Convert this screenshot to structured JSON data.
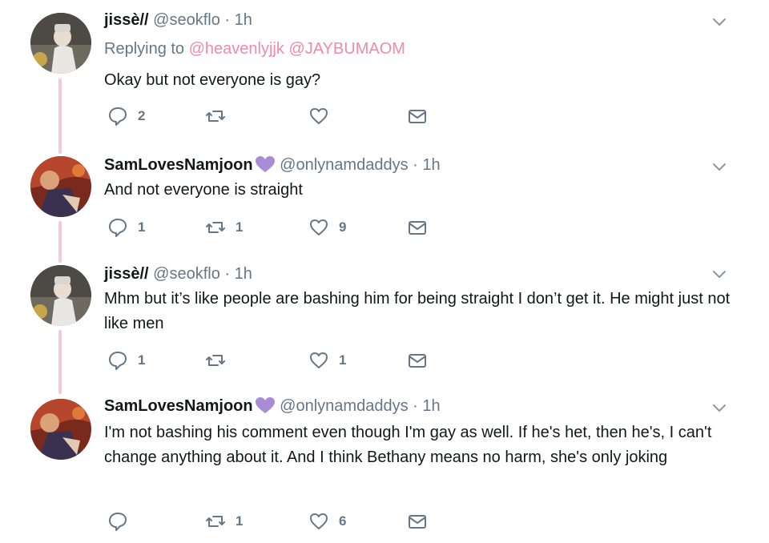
{
  "tweets": [
    {
      "name": "jissè//",
      "handle": "@seokflo",
      "sep": "·",
      "time": "1h",
      "replying_label": "Replying to",
      "mentions": "@heavenlyjjk @JAYBUMAOM",
      "text": "Okay but not everyone is gay?",
      "reply_count": "2",
      "retweet_count": "",
      "like_count": ""
    },
    {
      "name": "SamLovesNamjoon",
      "handle": "@onlynamdaddys",
      "sep": "·",
      "time": "1h",
      "text": "And not everyone is straight",
      "reply_count": "1",
      "retweet_count": "1",
      "like_count": "9"
    },
    {
      "name": "jissè//",
      "handle": "@seokflo",
      "sep": "·",
      "time": "1h",
      "text": "Mhm but it’s like people are bashing him for being straight I don’t get it. He might just not like men",
      "reply_count": "1",
      "retweet_count": "",
      "like_count": "1"
    },
    {
      "name": "SamLovesNamjoon",
      "handle": "@onlynamdaddys",
      "sep": "·",
      "time": "1h",
      "text": "I'm not bashing his comment even though I'm gay as well. If he's het, then he's, I can't change anything about it. And I think Bethany means no harm, she's only joking",
      "reply_count": "",
      "retweet_count": "1",
      "like_count": "6"
    }
  ],
  "icons": {
    "reply": "reply-bubble-icon",
    "retweet": "retweet-arrows-icon",
    "like": "heart-outline-icon",
    "dm": "envelope-icon",
    "caret": "chevron-down-icon",
    "name_badge": "purple-heart-icon"
  },
  "colors": {
    "accent_mention": "#f08aa8",
    "thread_line": "#f7c8d8",
    "muted": "#657786",
    "badge_heart": "#a98bd6"
  }
}
